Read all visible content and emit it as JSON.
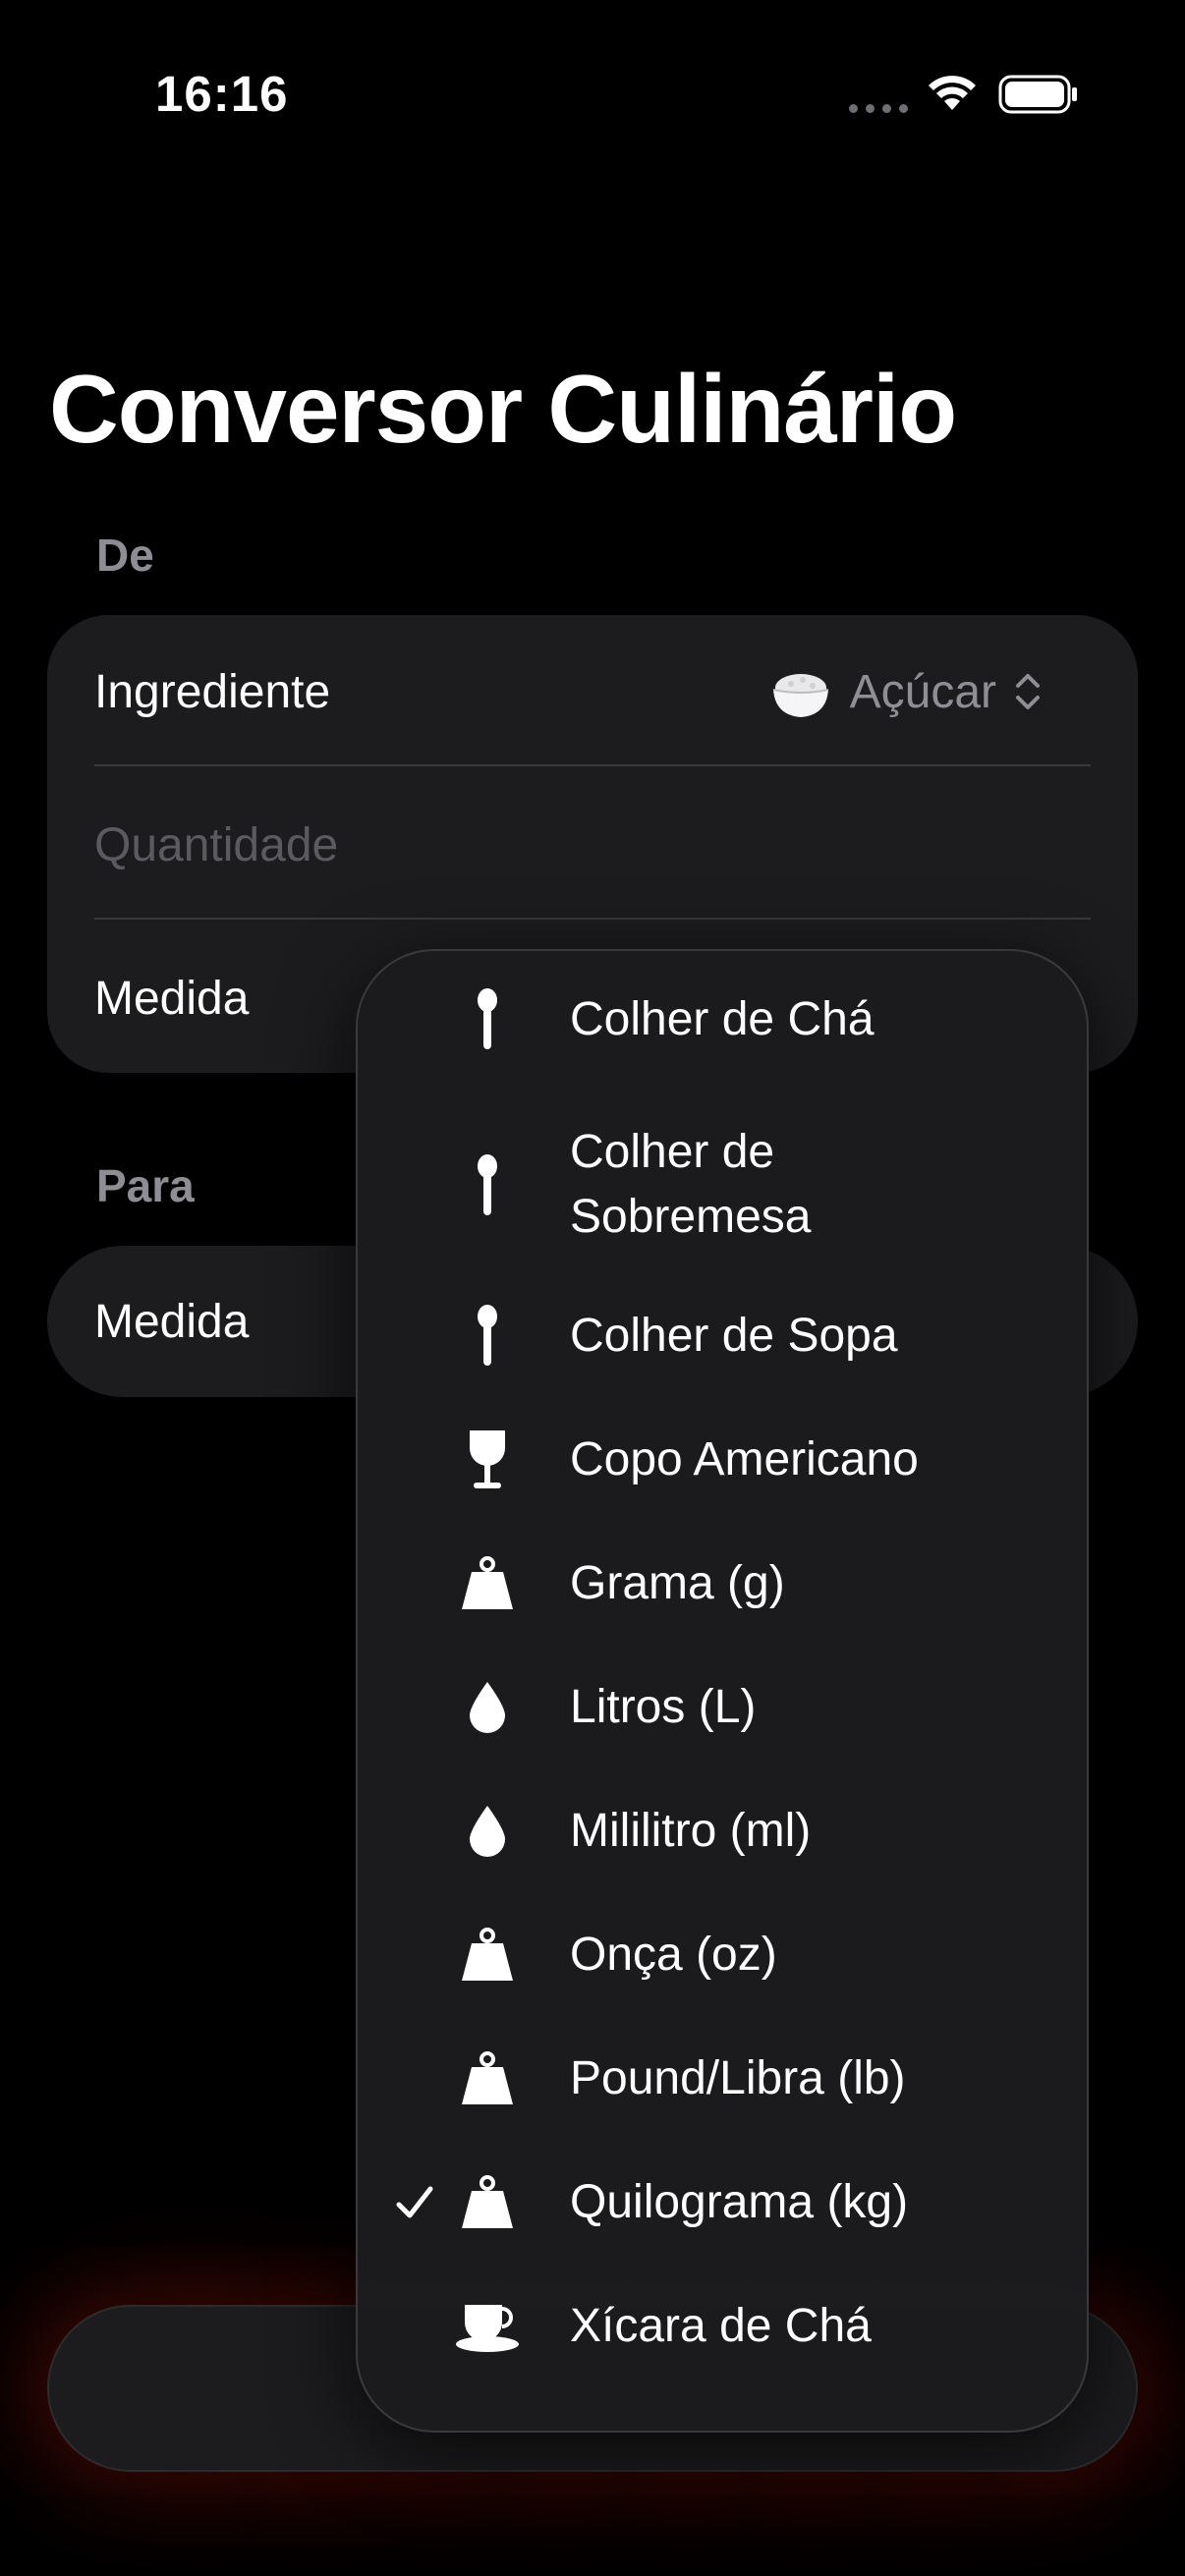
{
  "status_bar": {
    "time": "16:16"
  },
  "title": "Conversor Culinário",
  "from_section": {
    "label": "De",
    "ingredient_label": "Ingrediente",
    "ingredient_value": "Açúcar",
    "quantity_placeholder": "Quantidade",
    "measure_label": "Medida"
  },
  "to_section": {
    "label": "Para",
    "measure_label": "Medida"
  },
  "menu": {
    "items": [
      {
        "label": "Colher de Chá",
        "icon": "spoon-icon",
        "selected": false
      },
      {
        "label": "Colher de Sobremesa",
        "icon": "spoon-icon",
        "selected": false
      },
      {
        "label": "Colher de Sopa",
        "icon": "spoon-icon",
        "selected": false
      },
      {
        "label": "Copo Americano",
        "icon": "wineglass-icon",
        "selected": false
      },
      {
        "label": "Grama (g)",
        "icon": "scale-weight-icon",
        "selected": false
      },
      {
        "label": "Litros (L)",
        "icon": "drop-icon",
        "selected": false
      },
      {
        "label": "Mililitro (ml)",
        "icon": "drop-icon",
        "selected": false
      },
      {
        "label": "Onça (oz)",
        "icon": "scale-weight-icon",
        "selected": false
      },
      {
        "label": "Pound/Libra (lb)",
        "icon": "scale-weight-icon",
        "selected": false
      },
      {
        "label": "Quilograma (kg)",
        "icon": "scale-weight-icon",
        "selected": true
      },
      {
        "label": "Xícara de Chá",
        "icon": "teacup-icon",
        "selected": false
      }
    ]
  },
  "colors": {
    "background": "#000000",
    "card": "#1c1c1e",
    "accent_glow": "#8c140a",
    "secondary_text": "#8e8e93"
  }
}
